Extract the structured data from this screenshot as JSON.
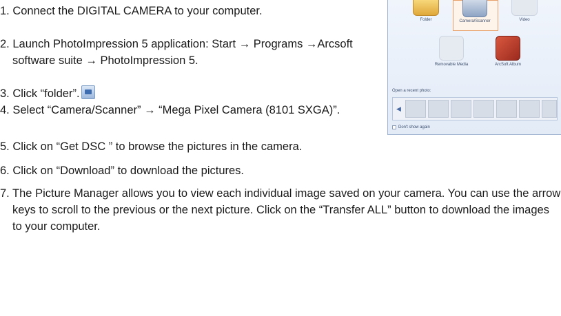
{
  "steps": [
    {
      "text": "1. Connect the DIGITAL CAMERA to your computer."
    },
    {
      "text": "2. Launch PhotoImpression 5 application: Start → Programs →Arcsoft software suite → PhotoImpression 5."
    },
    {
      "text": "3. Click “folder”.",
      "icon": "folder-app-icon"
    },
    {
      "text": "4. Select “Camera/Scanner” → “Mega Pixel Camera (8101 SXGA)”."
    },
    {
      "text": "5. Click on “Get DSC ” to browse the pictures in the camera."
    },
    {
      "text": "6. Click on “Download” to download the pictures."
    },
    {
      "text": "7. The Picture Manager allows you to view each individual image saved on your camera. You can use the arrow keys to scroll to the previous or the next picture. Click on the “Transfer ALL” button to download the images to your computer."
    }
  ],
  "dialog": {
    "tiles": [
      {
        "label": "Folder",
        "icon": "folder-icon"
      },
      {
        "label": "Camera/Scanner",
        "icon": "camera-scanner-icon",
        "selected": true
      },
      {
        "label": "Video",
        "icon": "video-icon"
      },
      {
        "label": "Removable Media",
        "icon": "removable-media-icon"
      },
      {
        "label": "ArcSoft Album",
        "icon": "arcsoft-album-icon"
      }
    ],
    "recent_label": "Open a recent photo:",
    "dont_show_label": "Don't show again",
    "colors": {
      "panel": "#e3ebf7",
      "selected_border": "#e8a06a",
      "album_red": "#c0392b"
    }
  }
}
